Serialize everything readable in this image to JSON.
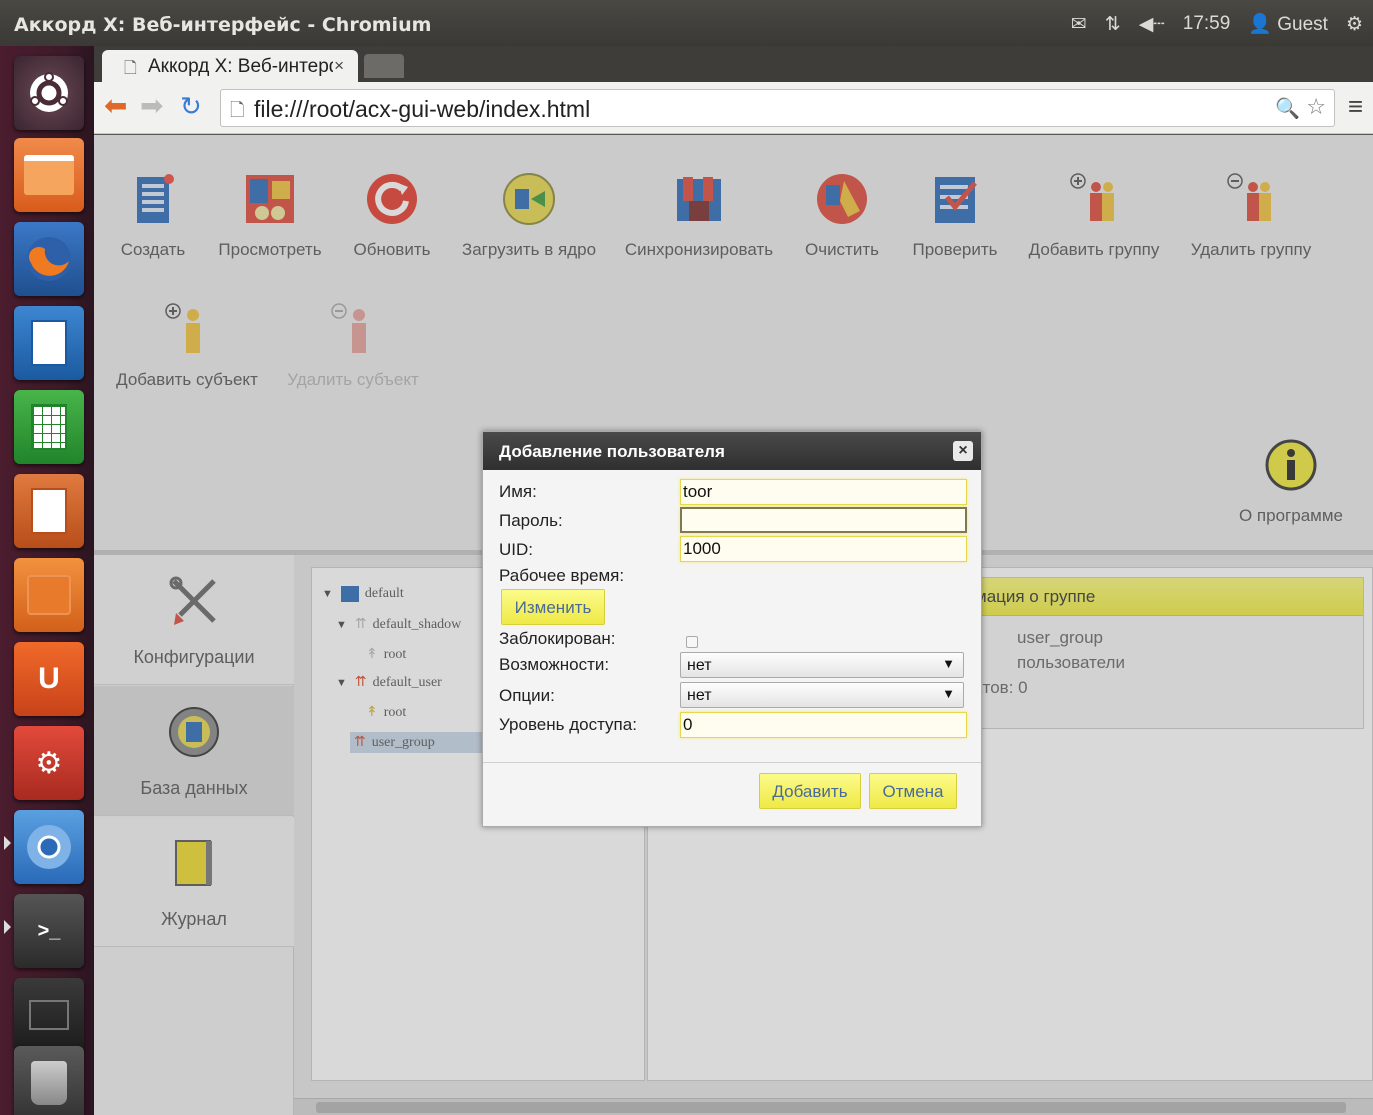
{
  "window": {
    "title": "Аккорд X: Веб-интерфейс - Chromium"
  },
  "tray": {
    "mail_icon": "envelope-icon",
    "network_icon": "network-arrows-icon",
    "sound_icon": "speaker-icon",
    "time": "17:59",
    "user": "Guest",
    "session_icon": "gear-power-icon"
  },
  "browser": {
    "tab_title": "Аккорд X: Веб-интерфейс",
    "tab_close": "×",
    "url": "file:///root/acx-gui-web/index.html",
    "menu": "≡"
  },
  "actions": [
    {
      "label": "Создать",
      "icon": "create-list-icon"
    },
    {
      "label": "Просмотреть",
      "icon": "view-icon"
    },
    {
      "label": "Обновить",
      "icon": "refresh-icon"
    },
    {
      "label": "Загрузить в ядро",
      "icon": "load-to-kernel-icon"
    },
    {
      "label": "Синхронизировать",
      "icon": "sync-icon"
    },
    {
      "label": "Очистить",
      "icon": "clean-icon"
    },
    {
      "label": "Проверить",
      "icon": "check-icon"
    },
    {
      "label": "Добавить группу",
      "icon": "add-group-icon"
    },
    {
      "label": "Удалить группу",
      "icon": "remove-group-icon"
    },
    {
      "label": "Добавить субъект",
      "icon": "add-subject-icon"
    },
    {
      "label": "Удалить субъект",
      "icon": "remove-subject-icon",
      "disabled": true
    }
  ],
  "about": {
    "label": "О программе",
    "icon": "info-icon"
  },
  "nav": [
    {
      "label": "Конфигурации",
      "icon": "tools-icon"
    },
    {
      "label": "База данных",
      "icon": "database-icon"
    },
    {
      "label": "Журнал",
      "icon": "journal-icon"
    }
  ],
  "tree": {
    "nodes": [
      {
        "label": "default",
        "expanded": true
      },
      {
        "label": "default_shadow",
        "expanded": true
      },
      {
        "label": "root"
      },
      {
        "label": "default_user",
        "expanded": true
      },
      {
        "label": "root"
      },
      {
        "label": "user_group",
        "selected": true
      }
    ]
  },
  "info": {
    "header": "мация о группе",
    "name": "user_group",
    "type": "пользователи",
    "count": "ктов: 0"
  },
  "dialog": {
    "title": "Добавление пользователя",
    "close": "×",
    "fields": {
      "name_label": "Имя:",
      "name_value": "toor",
      "password_label": "Пароль:",
      "password_value": "",
      "uid_label": "UID:",
      "uid_value": "1000",
      "worktime_label": "Рабочее время:",
      "worktime_button": "Изменить",
      "locked_label": "Заблокирован:",
      "caps_label": "Возможности:",
      "caps_value": "нет",
      "options_label": "Опции:",
      "options_value": "нет",
      "access_label": "Уровень доступа:",
      "access_value": "0"
    },
    "add_button": "Добавить",
    "cancel_button": "Отмена"
  },
  "colors": {
    "accent_yellow": "#f1ee3d",
    "dialog_header": "#2f2f2f",
    "launcher": "#3c1a27"
  }
}
